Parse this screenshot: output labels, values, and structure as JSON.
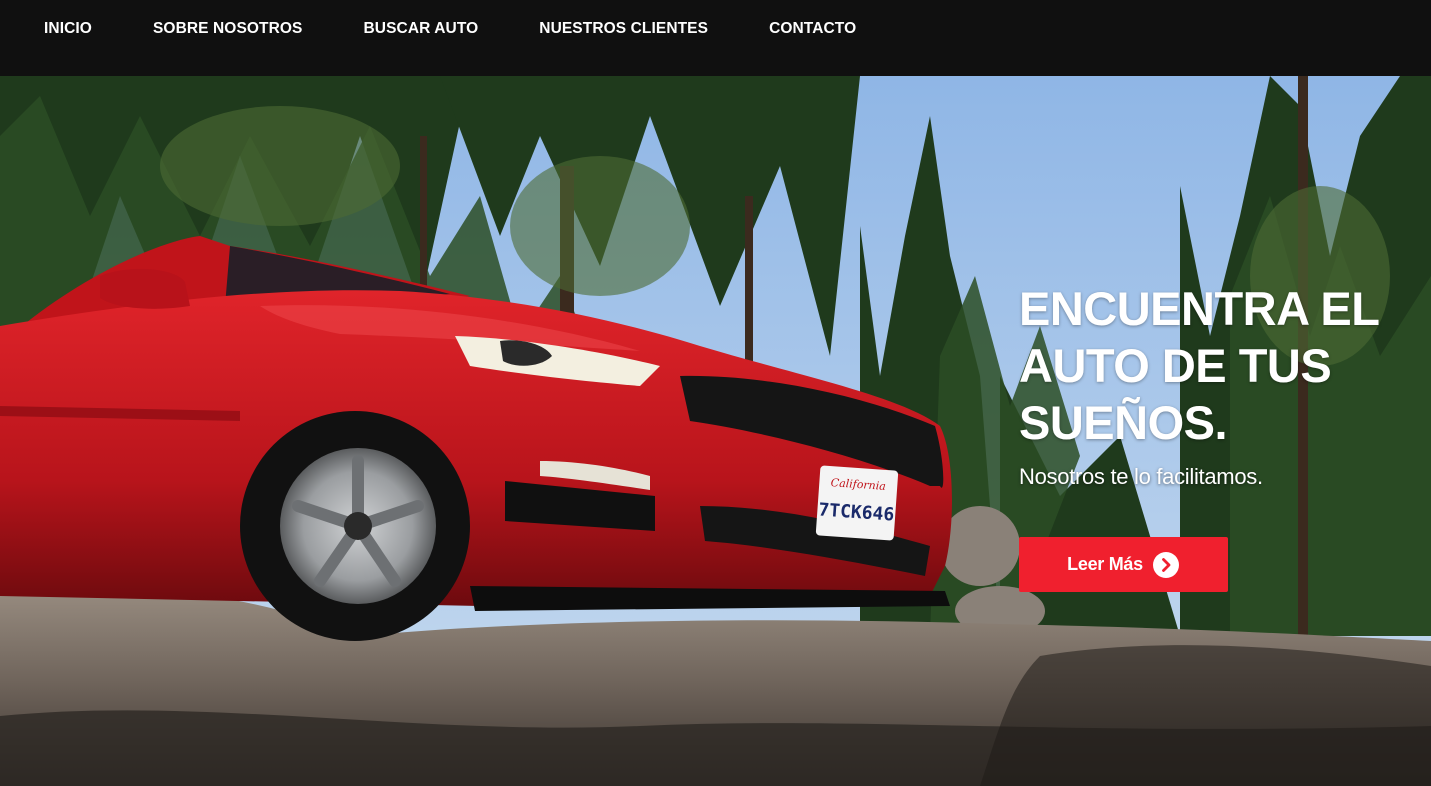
{
  "nav": {
    "items": [
      {
        "label": "INICIO"
      },
      {
        "label": "SOBRE NOSOTROS"
      },
      {
        "label": "BUSCAR AUTO"
      },
      {
        "label": "NUESTROS CLIENTES"
      },
      {
        "label": "CONTACTO"
      }
    ]
  },
  "hero": {
    "heading": "ENCUENTRA EL AUTO DE TUS SUEÑOS.",
    "subheading": "Nosotros te lo facilitamos.",
    "cta_label": "Leer Más",
    "cta_icon": "chevron-right-circle-icon",
    "image": {
      "plate_state": "California",
      "plate_number": "7TCK646"
    }
  },
  "colors": {
    "navbar_bg": "#101010",
    "accent": "#f0202e",
    "text": "#ffffff",
    "car": "#c8141c"
  }
}
